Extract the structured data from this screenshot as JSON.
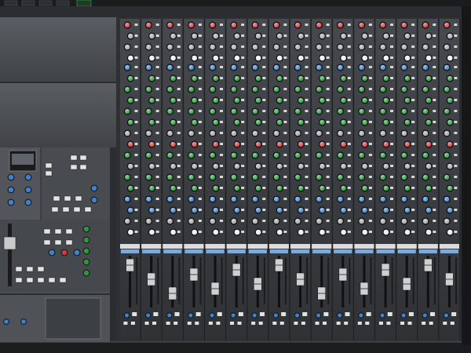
{
  "scene": {
    "subject": "mixing-console",
    "channel_strip_count": 16,
    "fader_count": 16,
    "knob_colors": {
      "red": "#d23a3a",
      "green": "#2e9a3e",
      "blue": "#3d83d0",
      "gray": "#a3a7ad",
      "white": "#e8eaec"
    },
    "panel_colors": {
      "surface": "#2b2d30",
      "panel": "#3a3d41",
      "master_panel": "#4d5055",
      "backdrop": "#e9e9e9"
    }
  }
}
